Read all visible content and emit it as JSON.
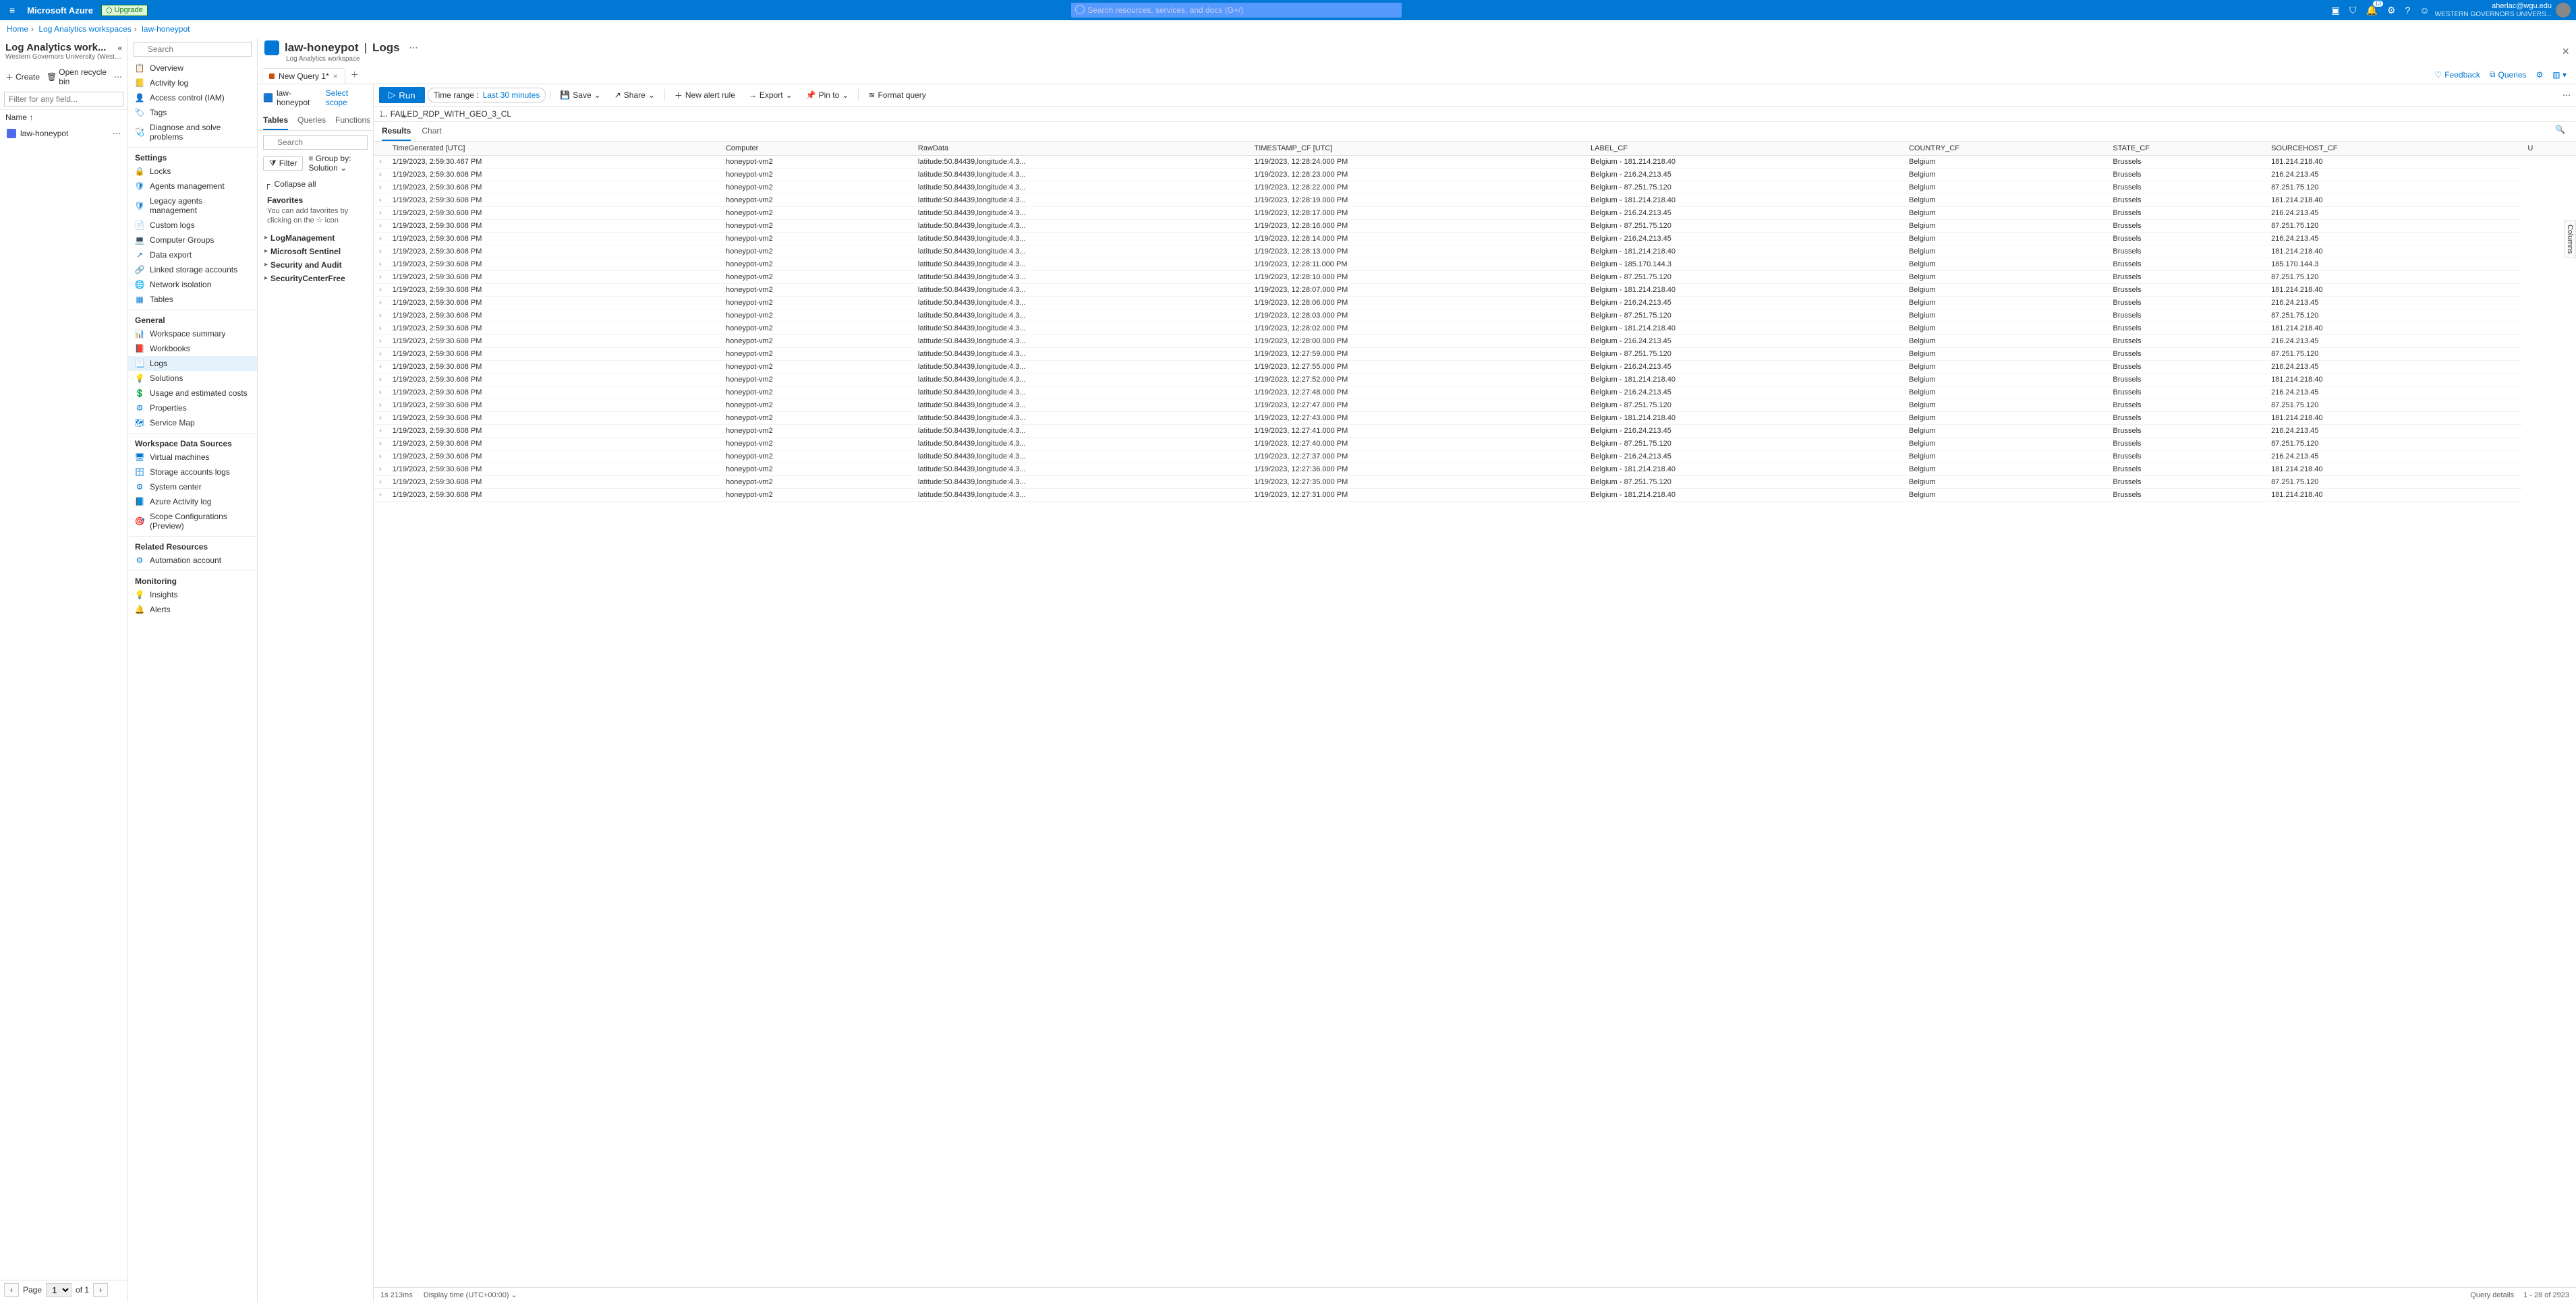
{
  "topbar": {
    "brand": "Microsoft Azure",
    "upgrade": "Upgrade",
    "search_placeholder": "Search resources, services, and docs (G+/)",
    "account_email": "aherlac@wgu.edu",
    "account_org": "WESTERN GOVERNORS UNIVERS..."
  },
  "breadcrumb": {
    "items": [
      "Home",
      "Log Analytics workspaces",
      "law-honeypot"
    ]
  },
  "col1": {
    "title": "Log Analytics work...",
    "subtitle": "Western Governors University (WesternGovernors...",
    "create": "Create",
    "recycle": "Open recycle bin",
    "filter_placeholder": "Filter for any field...",
    "name_header": "Name ↑",
    "workspace": "law-honeypot",
    "page_label": "Page",
    "page_value": "1",
    "page_of": "of 1"
  },
  "col2": {
    "search_placeholder": "Search",
    "sections": [
      {
        "items": [
          {
            "icon": "📋",
            "label": "Overview"
          },
          {
            "icon": "📒",
            "label": "Activity log"
          },
          {
            "icon": "👤",
            "label": "Access control (IAM)"
          },
          {
            "icon": "🏷",
            "label": "Tags"
          },
          {
            "icon": "🩺",
            "label": "Diagnose and solve problems"
          }
        ]
      },
      {
        "header": "Settings",
        "items": [
          {
            "icon": "🔒",
            "label": "Locks"
          },
          {
            "icon": "🛡",
            "label": "Agents management"
          },
          {
            "icon": "🛡",
            "label": "Legacy agents management"
          },
          {
            "icon": "📄",
            "label": "Custom logs"
          },
          {
            "icon": "💻",
            "label": "Computer Groups"
          },
          {
            "icon": "↗",
            "label": "Data export"
          },
          {
            "icon": "🔗",
            "label": "Linked storage accounts"
          },
          {
            "icon": "🌐",
            "label": "Network isolation"
          },
          {
            "icon": "▦",
            "label": "Tables"
          }
        ]
      },
      {
        "header": "General",
        "items": [
          {
            "icon": "📊",
            "label": "Workspace summary"
          },
          {
            "icon": "📕",
            "label": "Workbooks"
          },
          {
            "icon": "📃",
            "label": "Logs",
            "active": true
          },
          {
            "icon": "💡",
            "label": "Solutions"
          },
          {
            "icon": "💲",
            "label": "Usage and estimated costs"
          },
          {
            "icon": "⚙",
            "label": "Properties"
          },
          {
            "icon": "🗺",
            "label": "Service Map"
          }
        ]
      },
      {
        "header": "Workspace Data Sources",
        "items": [
          {
            "icon": "🖥",
            "label": "Virtual machines"
          },
          {
            "icon": "🗄",
            "label": "Storage accounts logs"
          },
          {
            "icon": "⚙",
            "label": "System center"
          },
          {
            "icon": "📘",
            "label": "Azure Activity log"
          },
          {
            "icon": "🎯",
            "label": "Scope Configurations (Preview)"
          }
        ]
      },
      {
        "header": "Related Resources",
        "items": [
          {
            "icon": "⚙",
            "label": "Automation account"
          }
        ]
      },
      {
        "header": "Monitoring",
        "items": [
          {
            "icon": "💡",
            "label": "Insights"
          },
          {
            "icon": "🔔",
            "label": "Alerts"
          }
        ]
      }
    ]
  },
  "page": {
    "title_ws": "law-honeypot",
    "title_page": "Logs",
    "subtitle": "Log Analytics workspace"
  },
  "qtab": {
    "label": "New Query 1*"
  },
  "tabs_right": {
    "feedback": "Feedback",
    "queries": "Queries"
  },
  "scope": {
    "ws": "law-honeypot",
    "select": "Select scope"
  },
  "toolbar": {
    "run": "Run",
    "time_label": "Time range :",
    "time_value": "Last 30 minutes",
    "save": "Save",
    "share": "Share",
    "alert": "New alert rule",
    "export": "Export",
    "pin": "Pin to",
    "format": "Format query"
  },
  "editor": {
    "line": "1",
    "code": "FAILED_RDP_WITH_GEO_3_CL"
  },
  "tp_tabs": [
    "Tables",
    "Queries",
    "Functions"
  ],
  "tp_search_placeholder": "Search",
  "filter_label": "Filter",
  "groupby_label": "Group by: Solution",
  "collapse_label": "Collapse all",
  "favorites_header": "Favorites",
  "favorites_hint": "You can add favorites by clicking on the ☆ icon",
  "tree": [
    "LogManagement",
    "Microsoft Sentinel",
    "Security and Audit",
    "SecurityCenterFree"
  ],
  "res_tabs": [
    "Results",
    "Chart"
  ],
  "columns_label": "Columns",
  "table": {
    "headers": [
      "TimeGenerated [UTC]",
      "Computer",
      "RawData",
      "TIMESTAMP_CF [UTC]",
      "LABEL_CF",
      "COUNTRY_CF",
      "STATE_CF",
      "SOURCEHOST_CF",
      "U"
    ],
    "rows": [
      [
        "1/19/2023, 2:59:30.467 PM",
        "honeypot-vm2",
        "latitude:50.84439,longitude:4.3...",
        "1/19/2023, 12:28:24.000 PM",
        "Belgium - 181.214.218.40",
        "Belgium",
        "Brussels",
        "181.214.218.40"
      ],
      [
        "1/19/2023, 2:59:30.608 PM",
        "honeypot-vm2",
        "latitude:50.84439,longitude:4.3...",
        "1/19/2023, 12:28:23.000 PM",
        "Belgium - 216.24.213.45",
        "Belgium",
        "Brussels",
        "216.24.213.45"
      ],
      [
        "1/19/2023, 2:59:30.608 PM",
        "honeypot-vm2",
        "latitude:50.84439,longitude:4.3...",
        "1/19/2023, 12:28:22.000 PM",
        "Belgium - 87.251.75.120",
        "Belgium",
        "Brussels",
        "87.251.75.120"
      ],
      [
        "1/19/2023, 2:59:30.608 PM",
        "honeypot-vm2",
        "latitude:50.84439,longitude:4.3...",
        "1/19/2023, 12:28:19.000 PM",
        "Belgium - 181.214.218.40",
        "Belgium",
        "Brussels",
        "181.214.218.40"
      ],
      [
        "1/19/2023, 2:59:30.608 PM",
        "honeypot-vm2",
        "latitude:50.84439,longitude:4.3...",
        "1/19/2023, 12:28:17.000 PM",
        "Belgium - 216.24.213.45",
        "Belgium",
        "Brussels",
        "216.24.213.45"
      ],
      [
        "1/19/2023, 2:59:30.608 PM",
        "honeypot-vm2",
        "latitude:50.84439,longitude:4.3...",
        "1/19/2023, 12:28:16.000 PM",
        "Belgium - 87.251.75.120",
        "Belgium",
        "Brussels",
        "87.251.75.120"
      ],
      [
        "1/19/2023, 2:59:30.608 PM",
        "honeypot-vm2",
        "latitude:50.84439,longitude:4.3...",
        "1/19/2023, 12:28:14.000 PM",
        "Belgium - 216.24.213.45",
        "Belgium",
        "Brussels",
        "216.24.213.45"
      ],
      [
        "1/19/2023, 2:59:30.608 PM",
        "honeypot-vm2",
        "latitude:50.84439,longitude:4.3...",
        "1/19/2023, 12:28:13.000 PM",
        "Belgium - 181.214.218.40",
        "Belgium",
        "Brussels",
        "181.214.218.40"
      ],
      [
        "1/19/2023, 2:59:30.608 PM",
        "honeypot-vm2",
        "latitude:50.84439,longitude:4.3...",
        "1/19/2023, 12:28:11.000 PM",
        "Belgium - 185.170.144.3",
        "Belgium",
        "Brussels",
        "185.170.144.3"
      ],
      [
        "1/19/2023, 2:59:30.608 PM",
        "honeypot-vm2",
        "latitude:50.84439,longitude:4.3...",
        "1/19/2023, 12:28:10.000 PM",
        "Belgium - 87.251.75.120",
        "Belgium",
        "Brussels",
        "87.251.75.120"
      ],
      [
        "1/19/2023, 2:59:30.608 PM",
        "honeypot-vm2",
        "latitude:50.84439,longitude:4.3...",
        "1/19/2023, 12:28:07.000 PM",
        "Belgium - 181.214.218.40",
        "Belgium",
        "Brussels",
        "181.214.218.40"
      ],
      [
        "1/19/2023, 2:59:30.608 PM",
        "honeypot-vm2",
        "latitude:50.84439,longitude:4.3...",
        "1/19/2023, 12:28:06.000 PM",
        "Belgium - 216.24.213.45",
        "Belgium",
        "Brussels",
        "216.24.213.45"
      ],
      [
        "1/19/2023, 2:59:30.608 PM",
        "honeypot-vm2",
        "latitude:50.84439,longitude:4.3...",
        "1/19/2023, 12:28:03.000 PM",
        "Belgium - 87.251.75.120",
        "Belgium",
        "Brussels",
        "87.251.75.120"
      ],
      [
        "1/19/2023, 2:59:30.608 PM",
        "honeypot-vm2",
        "latitude:50.84439,longitude:4.3...",
        "1/19/2023, 12:28:02.000 PM",
        "Belgium - 181.214.218.40",
        "Belgium",
        "Brussels",
        "181.214.218.40"
      ],
      [
        "1/19/2023, 2:59:30.608 PM",
        "honeypot-vm2",
        "latitude:50.84439,longitude:4.3...",
        "1/19/2023, 12:28:00.000 PM",
        "Belgium - 216.24.213.45",
        "Belgium",
        "Brussels",
        "216.24.213.45"
      ],
      [
        "1/19/2023, 2:59:30.608 PM",
        "honeypot-vm2",
        "latitude:50.84439,longitude:4.3...",
        "1/19/2023, 12:27:59.000 PM",
        "Belgium - 87.251.75.120",
        "Belgium",
        "Brussels",
        "87.251.75.120"
      ],
      [
        "1/19/2023, 2:59:30.608 PM",
        "honeypot-vm2",
        "latitude:50.84439,longitude:4.3...",
        "1/19/2023, 12:27:55.000 PM",
        "Belgium - 216.24.213.45",
        "Belgium",
        "Brussels",
        "216.24.213.45"
      ],
      [
        "1/19/2023, 2:59:30.608 PM",
        "honeypot-vm2",
        "latitude:50.84439,longitude:4.3...",
        "1/19/2023, 12:27:52.000 PM",
        "Belgium - 181.214.218.40",
        "Belgium",
        "Brussels",
        "181.214.218.40"
      ],
      [
        "1/19/2023, 2:59:30.608 PM",
        "honeypot-vm2",
        "latitude:50.84439,longitude:4.3...",
        "1/19/2023, 12:27:48.000 PM",
        "Belgium - 216.24.213.45",
        "Belgium",
        "Brussels",
        "216.24.213.45"
      ],
      [
        "1/19/2023, 2:59:30.608 PM",
        "honeypot-vm2",
        "latitude:50.84439,longitude:4.3...",
        "1/19/2023, 12:27:47.000 PM",
        "Belgium - 87.251.75.120",
        "Belgium",
        "Brussels",
        "87.251.75.120"
      ],
      [
        "1/19/2023, 2:59:30.608 PM",
        "honeypot-vm2",
        "latitude:50.84439,longitude:4.3...",
        "1/19/2023, 12:27:43.000 PM",
        "Belgium - 181.214.218.40",
        "Belgium",
        "Brussels",
        "181.214.218.40"
      ],
      [
        "1/19/2023, 2:59:30.608 PM",
        "honeypot-vm2",
        "latitude:50.84439,longitude:4.3...",
        "1/19/2023, 12:27:41.000 PM",
        "Belgium - 216.24.213.45",
        "Belgium",
        "Brussels",
        "216.24.213.45"
      ],
      [
        "1/19/2023, 2:59:30.608 PM",
        "honeypot-vm2",
        "latitude:50.84439,longitude:4.3...",
        "1/19/2023, 12:27:40.000 PM",
        "Belgium - 87.251.75.120",
        "Belgium",
        "Brussels",
        "87.251.75.120"
      ],
      [
        "1/19/2023, 2:59:30.608 PM",
        "honeypot-vm2",
        "latitude:50.84439,longitude:4.3...",
        "1/19/2023, 12:27:37.000 PM",
        "Belgium - 216.24.213.45",
        "Belgium",
        "Brussels",
        "216.24.213.45"
      ],
      [
        "1/19/2023, 2:59:30.608 PM",
        "honeypot-vm2",
        "latitude:50.84439,longitude:4.3...",
        "1/19/2023, 12:27:36.000 PM",
        "Belgium - 181.214.218.40",
        "Belgium",
        "Brussels",
        "181.214.218.40"
      ],
      [
        "1/19/2023, 2:59:30.608 PM",
        "honeypot-vm2",
        "latitude:50.84439,longitude:4.3...",
        "1/19/2023, 12:27:35.000 PM",
        "Belgium - 87.251.75.120",
        "Belgium",
        "Brussels",
        "87.251.75.120"
      ],
      [
        "1/19/2023, 2:59:30.608 PM",
        "honeypot-vm2",
        "latitude:50.84439,longitude:4.3...",
        "1/19/2023, 12:27:31.000 PM",
        "Belgium - 181.214.218.40",
        "Belgium",
        "Brussels",
        "181.214.218.40"
      ]
    ]
  },
  "status": {
    "duration": "1s 213ms",
    "display_time": "Display time (UTC+00:00)",
    "query_details": "Query details",
    "count": "1 - 28 of 2923"
  }
}
